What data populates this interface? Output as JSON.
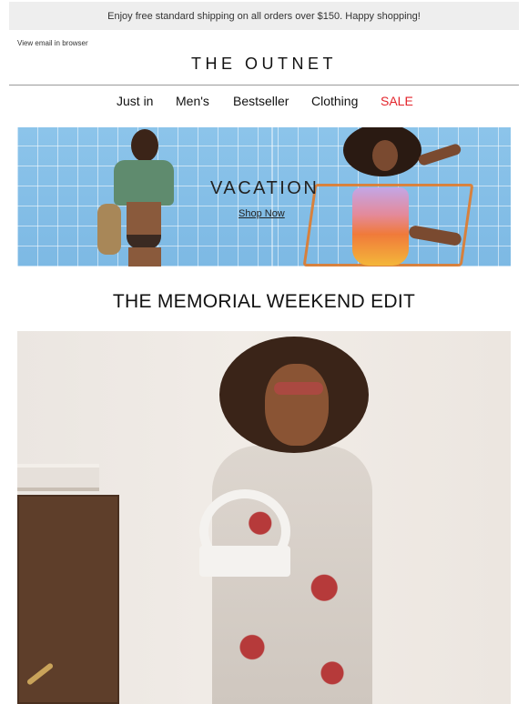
{
  "top_bar": {
    "text": "Enjoy free standard shipping on all orders over $150. Happy shopping!"
  },
  "header": {
    "view_in_browser": "View email in browser",
    "logo": "THE OUTNET"
  },
  "nav": {
    "items": [
      {
        "label": "Just in"
      },
      {
        "label": "Men's"
      },
      {
        "label": "Bestseller"
      },
      {
        "label": "Clothing"
      },
      {
        "label": "SALE"
      }
    ],
    "sale_color": "#e3242b"
  },
  "banner": {
    "title": "VACATION",
    "link": "Shop Now"
  },
  "section": {
    "title": "THE MEMORIAL WEEKEND EDIT"
  }
}
